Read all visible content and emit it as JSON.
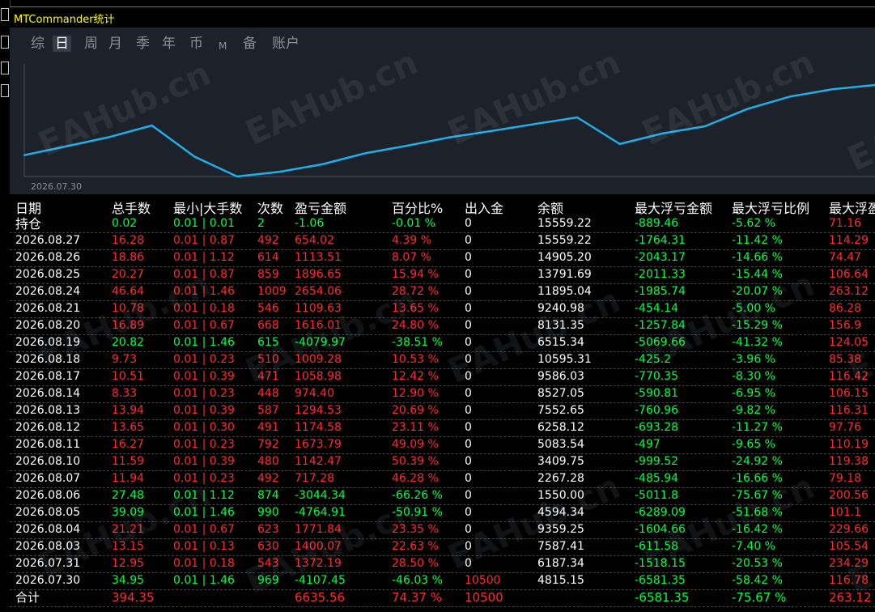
{
  "window": {
    "title": "MTCommander统计"
  },
  "tabs": [
    {
      "label": "综",
      "active": false
    },
    {
      "label": "日",
      "active": true
    },
    {
      "label": "周",
      "active": false
    },
    {
      "label": "月",
      "active": false
    },
    {
      "label": "季",
      "active": false
    },
    {
      "label": "年",
      "active": false
    },
    {
      "label": "币",
      "active": false
    },
    {
      "label": "M",
      "active": false
    },
    {
      "label": "备",
      "active": false
    },
    {
      "label": "账户",
      "active": false
    }
  ],
  "chart_data": {
    "type": "line",
    "x_start_label": "2026.07.30",
    "series": [
      {
        "values": [
          4815.15,
          6187.34,
          7587.41,
          9359.25,
          4594.34,
          1550.0,
          2267.28,
          3409.75,
          5083.54,
          6258.12,
          7552.65,
          8527.05,
          9586.03,
          10595.31,
          6515.34,
          8131.35,
          9240.98,
          11895.04,
          13791.69,
          14905.2,
          15559.22
        ]
      }
    ],
    "line_color": "#1fb0e8"
  },
  "watermark": "EAHub.cn",
  "table": {
    "headers": [
      "日期",
      "总手数",
      "最小|大手数",
      "次数",
      "盈亏金额",
      "百分比%",
      "出入金",
      "余额",
      "最大浮亏金额",
      "最大浮亏比例",
      "最大浮盈"
    ],
    "rows": [
      {
        "cells": [
          "持仓",
          "0.02",
          "0.01 | 0.01",
          "2",
          "-1.06",
          "-0.01 %",
          "0",
          "15559.22",
          "-889.46",
          "-5.62 %",
          "71.16"
        ],
        "tone": "green"
      },
      {
        "cells": [
          "2026.08.27",
          "16.28",
          "0.01 | 0.87",
          "492",
          "654.02",
          "4.39 %",
          "0",
          "15559.22",
          "-1764.31",
          "-11.42 %",
          "114.29"
        ],
        "tone": "red"
      },
      {
        "cells": [
          "2026.08.26",
          "18.86",
          "0.01 | 1.12",
          "614",
          "1113.51",
          "8.07 %",
          "0",
          "14905.20",
          "-2043.17",
          "-14.66 %",
          "74.47"
        ],
        "tone": "red"
      },
      {
        "cells": [
          "2026.08.25",
          "20.27",
          "0.01 | 0.87",
          "859",
          "1896.65",
          "15.94 %",
          "0",
          "13791.69",
          "-2011.33",
          "-15.44 %",
          "106.64"
        ],
        "tone": "red"
      },
      {
        "cells": [
          "2026.08.24",
          "46.64",
          "0.01 | 1.46",
          "1009",
          "2654.06",
          "28.72 %",
          "0",
          "11895.04",
          "-1985.74",
          "-20.07 %",
          "263.12"
        ],
        "tone": "red"
      },
      {
        "cells": [
          "2026.08.21",
          "10.78",
          "0.01 | 0.18",
          "546",
          "1109.63",
          "13.65 %",
          "0",
          "9240.98",
          "-454.14",
          "-5.00 %",
          "86.28"
        ],
        "tone": "red"
      },
      {
        "cells": [
          "2026.08.20",
          "16.89",
          "0.01 | 0.67",
          "668",
          "1616.01",
          "24.80 %",
          "0",
          "8131.35",
          "-1257.84",
          "-15.29 %",
          "156.9"
        ],
        "tone": "red"
      },
      {
        "cells": [
          "2026.08.19",
          "20.82",
          "0.01 | 1.46",
          "615",
          "-4079.97",
          "-38.51 %",
          "0",
          "6515.34",
          "-5069.66",
          "-41.32 %",
          "124.05"
        ],
        "tone": "green"
      },
      {
        "cells": [
          "2026.08.18",
          "9.73",
          "0.01 | 0.23",
          "510",
          "1009.28",
          "10.53 %",
          "0",
          "10595.31",
          "-425.2",
          "-3.96 %",
          "85.38"
        ],
        "tone": "red"
      },
      {
        "cells": [
          "2026.08.17",
          "10.51",
          "0.01 | 0.39",
          "471",
          "1058.98",
          "12.42 %",
          "0",
          "9586.03",
          "-770.35",
          "-8.30 %",
          "116.42"
        ],
        "tone": "red"
      },
      {
        "cells": [
          "2026.08.14",
          "8.33",
          "0.01 | 0.23",
          "448",
          "974.40",
          "12.90 %",
          "0",
          "8527.05",
          "-590.81",
          "-6.95 %",
          "106.15"
        ],
        "tone": "red"
      },
      {
        "cells": [
          "2026.08.13",
          "13.94",
          "0.01 | 0.39",
          "587",
          "1294.53",
          "20.69 %",
          "0",
          "7552.65",
          "-760.96",
          "-9.82 %",
          "116.31"
        ],
        "tone": "red"
      },
      {
        "cells": [
          "2026.08.12",
          "13.65",
          "0.01 | 0.30",
          "491",
          "1174.58",
          "23.11 %",
          "0",
          "6258.12",
          "-693.28",
          "-11.27 %",
          "97.76"
        ],
        "tone": "red"
      },
      {
        "cells": [
          "2026.08.11",
          "16.27",
          "0.01 | 0.23",
          "792",
          "1673.79",
          "49.09 %",
          "0",
          "5083.54",
          "-497",
          "-9.65 %",
          "110.19"
        ],
        "tone": "red"
      },
      {
        "cells": [
          "2026.08.10",
          "11.59",
          "0.01 | 0.39",
          "480",
          "1142.47",
          "50.39 %",
          "0",
          "3409.75",
          "-999.52",
          "-24.92 %",
          "119.38"
        ],
        "tone": "red"
      },
      {
        "cells": [
          "2026.08.07",
          "11.94",
          "0.01 | 0.23",
          "492",
          "717.28",
          "46.28 %",
          "0",
          "2267.28",
          "-485.94",
          "-16.66 %",
          "79.18"
        ],
        "tone": "red"
      },
      {
        "cells": [
          "2026.08.06",
          "27.48",
          "0.01 | 1.12",
          "874",
          "-3044.34",
          "-66.26 %",
          "0",
          "1550.00",
          "-5011.8",
          "-75.67 %",
          "200.56"
        ],
        "tone": "green"
      },
      {
        "cells": [
          "2026.08.05",
          "39.09",
          "0.01 | 1.46",
          "990",
          "-4764.91",
          "-50.91 %",
          "0",
          "4594.34",
          "-6289.09",
          "-51.68 %",
          "101.1"
        ],
        "tone": "green"
      },
      {
        "cells": [
          "2026.08.04",
          "21.21",
          "0.01 | 0.67",
          "623",
          "1771.84",
          "23.35 %",
          "0",
          "9359.25",
          "-1604.66",
          "-16.42 %",
          "229.66"
        ],
        "tone": "red"
      },
      {
        "cells": [
          "2026.08.03",
          "13.15",
          "0.01 | 0.13",
          "630",
          "1400.07",
          "22.63 %",
          "0",
          "7587.41",
          "-611.58",
          "-7.40 %",
          "105.54"
        ],
        "tone": "red"
      },
      {
        "cells": [
          "2026.07.31",
          "12.95",
          "0.01 | 0.18",
          "543",
          "1372.19",
          "28.50 %",
          "0",
          "6187.34",
          "-1518.15",
          "-20.53 %",
          "234.29"
        ],
        "tone": "red"
      },
      {
        "cells": [
          "2026.07.30",
          "34.95",
          "0.01 | 1.46",
          "969",
          "-4107.45",
          "-46.03 %",
          "10500",
          "4815.15",
          "-6581.35",
          "-58.42 %",
          "116.78"
        ],
        "tone": "green"
      }
    ],
    "total": {
      "cells": [
        "合计",
        "394.35",
        "",
        "",
        "6635.56",
        "74.37 %",
        "10500",
        "",
        "-6581.35",
        "-75.67 %",
        "263.12"
      ]
    }
  }
}
